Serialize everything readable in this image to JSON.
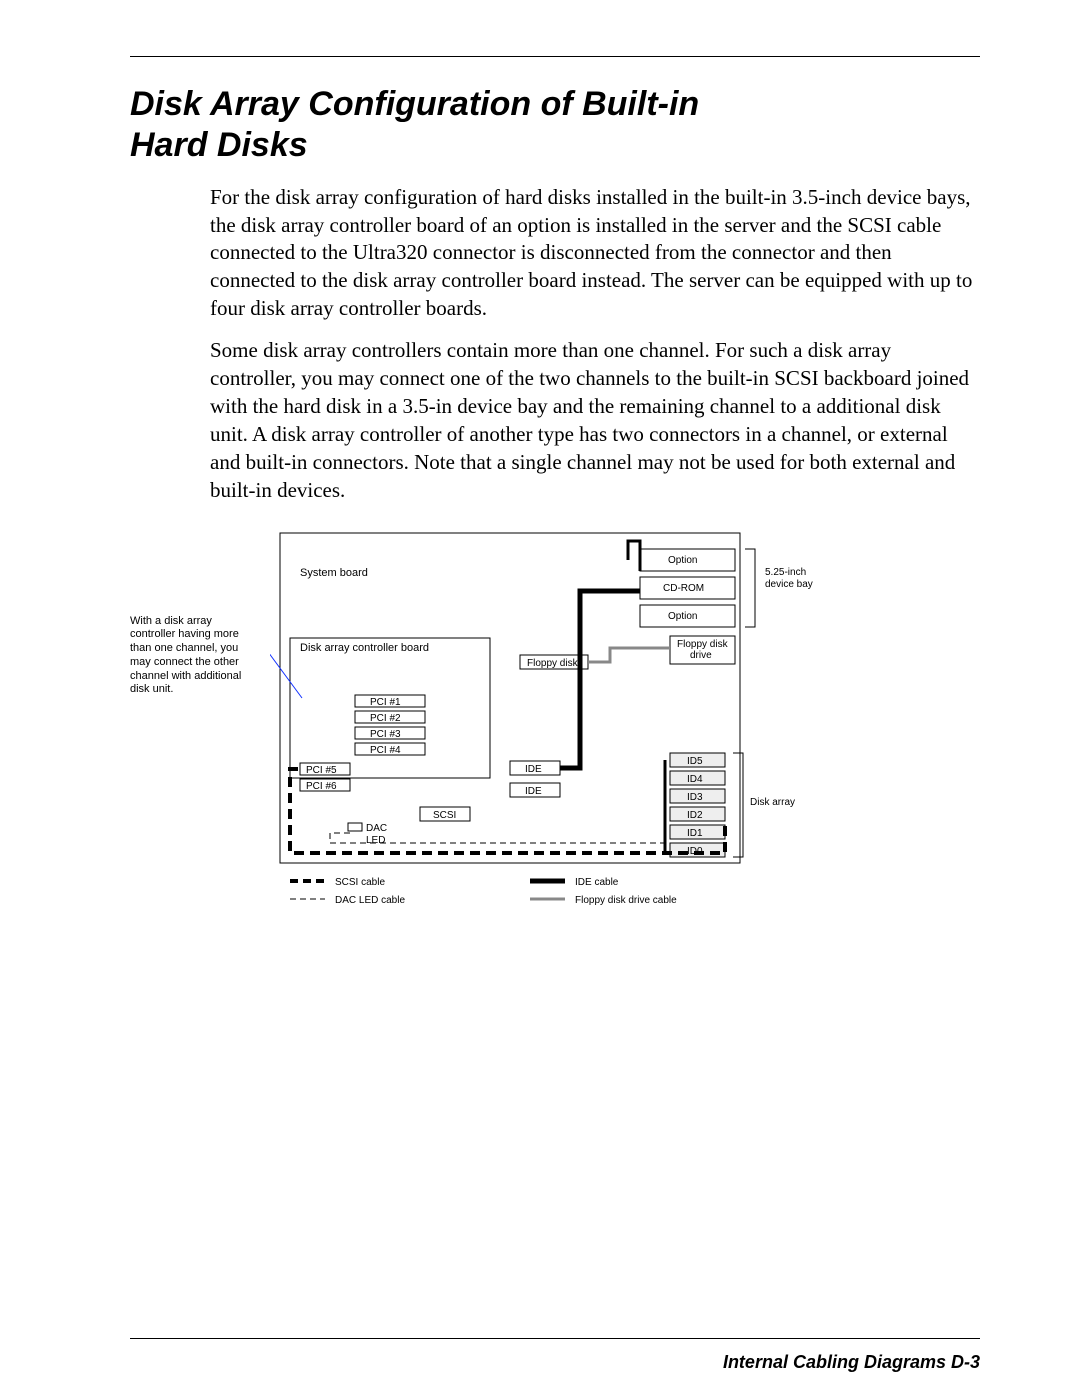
{
  "title": "Disk Array Configuration of Built-in Hard Disks",
  "para1": "For the disk array configuration of hard disks installed in the built-in 3.5-inch device bays, the disk array controller board of an option is installed in the server and the SCSI cable connected to the Ultra320 connector is disconnected from the connector and then connected to the disk array controller board instead.  The server can be equipped with up to four disk array controller boards.",
  "para2": "Some disk array controllers contain more than one channel.  For such a disk array controller, you may connect one of the two channels to the built-in SCSI backboard joined with the hard disk in a 3.5-in device bay and the remaining channel to a additional disk unit.  A disk array controller of another type has two connectors in a channel, or external and built-in connectors.  Note that a single channel may not be used for both external and built-in devices.",
  "side_note": "With a disk array controller having more than one channel, you may connect the other channel with additional disk unit.",
  "diagram": {
    "system_board": "System board",
    "dac_board": "Disk array controller board",
    "pci1": "PCI #1",
    "pci2": "PCI #2",
    "pci3": "PCI #3",
    "pci4": "PCI #4",
    "pci5": "PCI #5",
    "pci6": "PCI #6",
    "scsi": "SCSI",
    "dac": "DAC",
    "led": "LED",
    "ide": "IDE",
    "floppy": "Floppy disk",
    "option": "Option",
    "cdrom": "CD-ROM",
    "fdd": "Floppy disk drive",
    "id0": "ID0",
    "id1": "ID1",
    "id2": "ID2",
    "id3": "ID3",
    "id4": "ID4",
    "id5": "ID5",
    "bay525": "5.25-inch device bay",
    "disk_array": "Disk array",
    "legend_scsi": "SCSI cable",
    "legend_ide": "IDE cable",
    "legend_dac": "DAC LED cable",
    "legend_fdd": "Floppy disk drive cable"
  },
  "footer": "Internal Cabling Diagrams    D-3"
}
